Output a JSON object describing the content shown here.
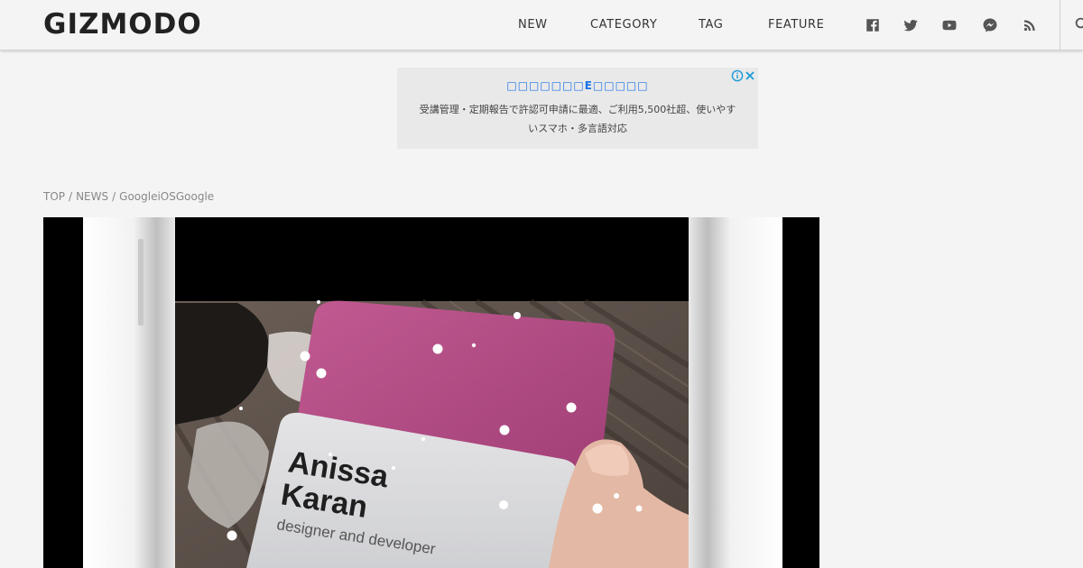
{
  "header": {
    "logo": "GIZMODO",
    "nav": [
      {
        "label": "NEW"
      },
      {
        "label": "CATEGORY"
      },
      {
        "label": "TAG"
      },
      {
        "label": "FEATURE"
      }
    ],
    "social_icons": [
      "facebook-icon",
      "twitter-icon",
      "youtube-icon",
      "messenger-icon",
      "rss-icon"
    ]
  },
  "ad": {
    "title": "□□□□□□□E□□□□□",
    "body": "受講管理・定期報告で許認可申請に最適、ご利用5,500社超、使いやすいスマホ・多言語対応"
  },
  "breadcrumb": {
    "items": [
      "TOP",
      "NEWS",
      "GoogleiOSGoogle"
    ],
    "separator": "/"
  },
  "hero": {
    "card_name_line1": "Anissa",
    "card_name_line2": "Karan",
    "card_subtitle": "designer and developer"
  },
  "colors": {
    "ad_title": "#1a73e8",
    "pink_card": "#b54a86"
  }
}
